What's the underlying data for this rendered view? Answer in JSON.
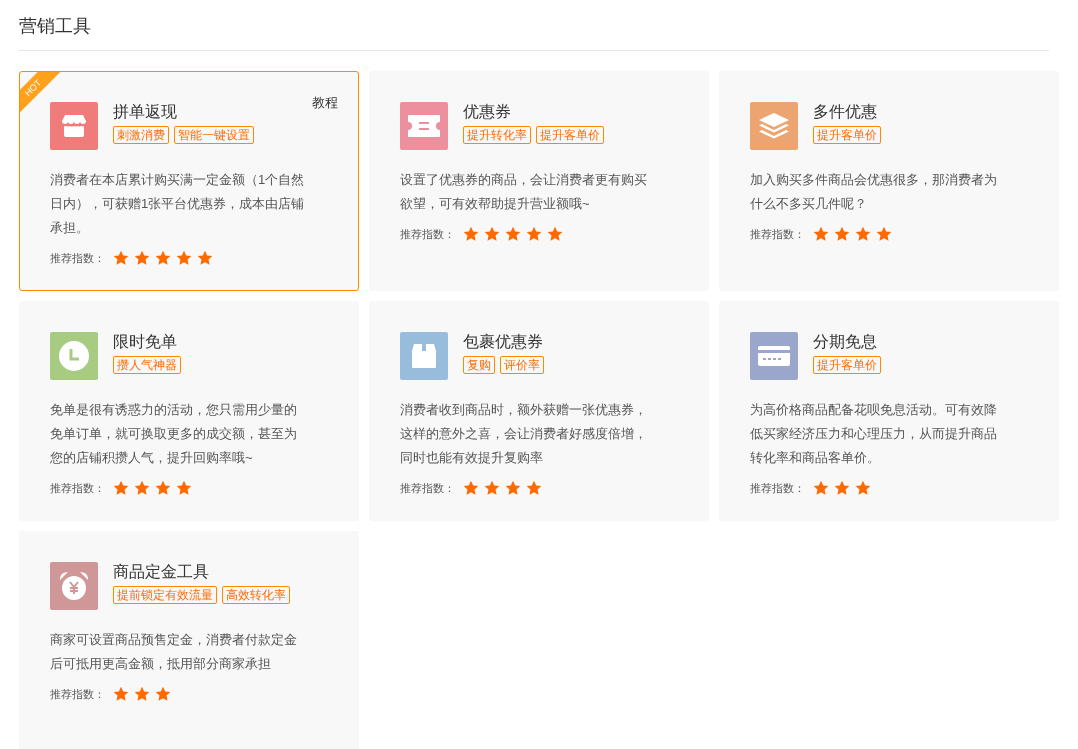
{
  "page_title": "营销工具",
  "cards": [
    {
      "title": "拼单返现",
      "kind": "store",
      "color": "#f07b7b",
      "tags": [
        "刺激消费",
        "智能一键设置"
      ],
      "description": "消费者在本店累计购买满一定金额（1个自然日内），可获赠1张平台优惠券，成本由店铺承担。",
      "rating_label": "推荐指数：",
      "stars": 5,
      "selected": true,
      "hot": "HOT",
      "tutorial": "教程"
    },
    {
      "title": "优惠券",
      "kind": "ticket",
      "color": "#ec909e",
      "tags": [
        "提升转化率",
        "提升客单价"
      ],
      "description": "设置了优惠券的商品，会让消费者更有购买欲望，可有效帮助提升营业额哦~",
      "rating_label": "推荐指数：",
      "stars": 5,
      "selected": false
    },
    {
      "title": "多件优惠",
      "kind": "layers",
      "color": "#eca570",
      "tags": [
        "提升客单价"
      ],
      "description": "加入购买多件商品会优惠很多，那消费者为什么不多买几件呢？",
      "rating_label": "推荐指数：",
      "stars": 4,
      "selected": false
    },
    {
      "title": "限时免单",
      "kind": "clock",
      "color": "#a8cb82",
      "tags": [
        "攒人气神器"
      ],
      "description": "免单是很有诱惑力的活动，您只需用少量的免单订单，就可换取更多的成交额，甚至为您的店铺积攒人气，提升回购率哦~",
      "rating_label": "推荐指数：",
      "stars": 4,
      "selected": false
    },
    {
      "title": "包裹优惠券",
      "kind": "box",
      "color": "#98bcdc",
      "tags": [
        "复购",
        "评价率"
      ],
      "description": "消费者收到商品时，额外获赠一张优惠券，这样的意外之喜，会让消费者好感度倍增，同时也能有效提升复购率",
      "rating_label": "推荐指数：",
      "stars": 4,
      "selected": false
    },
    {
      "title": "分期免息",
      "kind": "card",
      "color": "#9aa6cb",
      "tags": [
        "提升客单价"
      ],
      "description": "为高价格商品配备花呗免息活动。可有效降低买家经济压力和心理压力，从而提升商品转化率和商品客单价。",
      "rating_label": "推荐指数：",
      "stars": 3,
      "selected": false
    },
    {
      "title": "商品定金工具",
      "kind": "alarm",
      "color": "#cf9797",
      "tags": [
        "提前锁定有效流量",
        "高效转化率"
      ],
      "description": "商家可设置商品预售定金，消费者付款定金后可抵用更高金额，抵用部分商家承担",
      "rating_label": "推荐指数：",
      "stars": 3,
      "selected": false
    }
  ]
}
